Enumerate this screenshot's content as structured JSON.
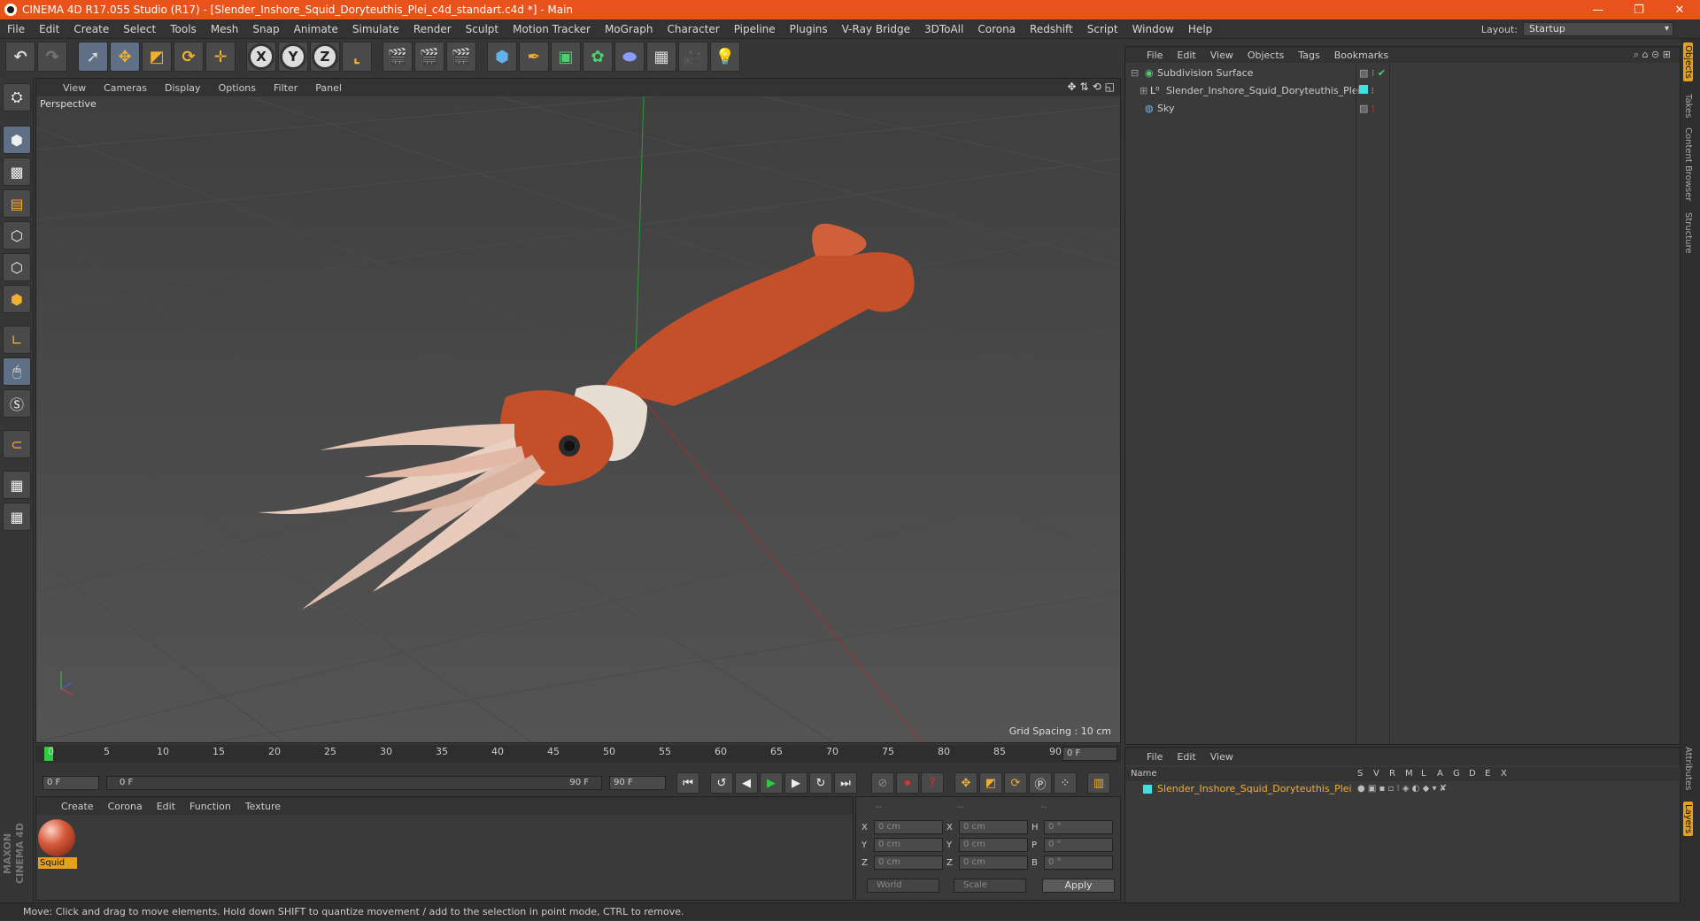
{
  "window": {
    "title": "CINEMA 4D R17.055 Studio (R17) - [Slender_Inshore_Squid_Doryteuthis_Plei_c4d_standart.c4d *] - Main",
    "controls": [
      "—",
      "❐",
      "✕"
    ]
  },
  "menubar": {
    "items": [
      "File",
      "Edit",
      "Create",
      "Select",
      "Tools",
      "Mesh",
      "Snap",
      "Animate",
      "Simulate",
      "Render",
      "Sculpt",
      "Motion Tracker",
      "MoGraph",
      "Character",
      "Pipeline",
      "Plugins",
      "V-Ray Bridge",
      "3DToAll",
      "Corona",
      "Redshift",
      "Script",
      "Window",
      "Help"
    ],
    "layout_label": "Layout:",
    "layout_value": "Startup"
  },
  "toolbar": {
    "axis_x": "X",
    "axis_y": "Y",
    "axis_z": "Z"
  },
  "viewport": {
    "menu": [
      "View",
      "Cameras",
      "Display",
      "Options",
      "Filter",
      "Panel"
    ],
    "label": "Perspective",
    "grid_spacing": "Grid Spacing : 10 cm"
  },
  "timeline": {
    "ticks": [
      "0",
      "5",
      "10",
      "15",
      "20",
      "25",
      "30",
      "35",
      "40",
      "45",
      "50",
      "55",
      "60",
      "65",
      "70",
      "75",
      "80",
      "85",
      "90"
    ],
    "current_frame": "0 F"
  },
  "playbar": {
    "start_frame": "0 F",
    "range_start": "0 F",
    "range_end": "90 F",
    "end_frame": "90 F"
  },
  "material_panel": {
    "menu": [
      "Create",
      "Corona",
      "Edit",
      "Function",
      "Texture"
    ],
    "material_name": "Squid"
  },
  "coords": {
    "header": [
      "--",
      "--",
      "--"
    ],
    "rows": [
      {
        "a": "X",
        "av": "0 cm",
        "b": "X",
        "bv": "0 cm",
        "c": "H",
        "cv": "0 °"
      },
      {
        "a": "Y",
        "av": "0 cm",
        "b": "Y",
        "bv": "0 cm",
        "c": "P",
        "cv": "0 °"
      },
      {
        "a": "Z",
        "av": "0 cm",
        "b": "Z",
        "bv": "0 cm",
        "c": "B",
        "cv": "0 °"
      }
    ],
    "world": "World",
    "scale": "Scale",
    "apply": "Apply"
  },
  "object_manager": {
    "menu": [
      "File",
      "Edit",
      "View",
      "Objects",
      "Tags",
      "Bookmarks"
    ],
    "objects": [
      "Subdivision Surface",
      "Slender_Inshore_Squid_Doryteuthis_Plei",
      "Sky"
    ]
  },
  "layer_manager": {
    "menu": [
      "File",
      "Edit",
      "View"
    ],
    "name_header": "Name",
    "col_headers": [
      "S",
      "V",
      "R",
      "M",
      "L",
      "A",
      "G",
      "D",
      "E",
      "X"
    ],
    "layer_name": "Slender_Inshore_Squid_Doryteuthis_Plei"
  },
  "right_tabs": [
    "Objects",
    "Takes",
    "Content Browser",
    "Structure",
    "Attributes",
    "Layers"
  ],
  "maxon_logo": "MAXON CINEMA 4D",
  "status": "Move: Click and drag to move elements. Hold down SHIFT to quantize movement / add to the selection in point mode, CTRL to remove."
}
